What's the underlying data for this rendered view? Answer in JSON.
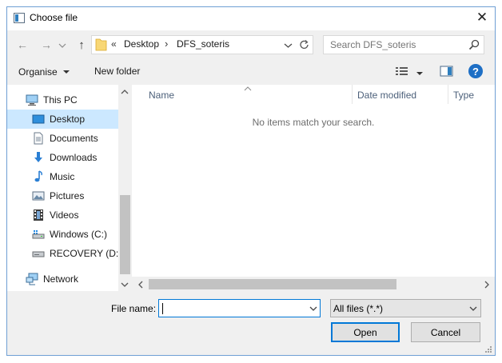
{
  "window": {
    "title": "Choose file",
    "close_glyph": "✕"
  },
  "nav": {
    "back_glyph": "←",
    "forward_glyph": "→",
    "up_glyph": "↑"
  },
  "address": {
    "overflow": "«",
    "crumbs": [
      "Desktop",
      "DFS_soteris"
    ],
    "separator": "›"
  },
  "search": {
    "placeholder": "Search DFS_soteris"
  },
  "toolbar": {
    "organise": "Organise",
    "new_folder": "New folder",
    "help": "?"
  },
  "sidebar": {
    "items": [
      {
        "label": "This PC",
        "icon": "this-pc-icon"
      },
      {
        "label": "Desktop",
        "icon": "desktop-icon",
        "selected": true
      },
      {
        "label": "Documents",
        "icon": "documents-icon"
      },
      {
        "label": "Downloads",
        "icon": "downloads-icon"
      },
      {
        "label": "Music",
        "icon": "music-icon"
      },
      {
        "label": "Pictures",
        "icon": "pictures-icon"
      },
      {
        "label": "Videos",
        "icon": "videos-icon"
      },
      {
        "label": "Windows (C:)",
        "icon": "drive-c-icon"
      },
      {
        "label": "RECOVERY (D:)",
        "icon": "drive-d-icon"
      },
      {
        "label": "Network",
        "icon": "network-icon"
      }
    ]
  },
  "columns": {
    "name": "Name",
    "date_modified": "Date modified",
    "type": "Type"
  },
  "content": {
    "empty_message": "No items match your search."
  },
  "footer": {
    "file_name_label": "File name:",
    "file_name_value": "",
    "filter_value": "All files (*.*)",
    "open_button": "Open",
    "cancel_button": "Cancel"
  },
  "colors": {
    "selection": "#cce8ff",
    "border_accent": "#0078d7",
    "help_blue": "#1e6fc5"
  }
}
